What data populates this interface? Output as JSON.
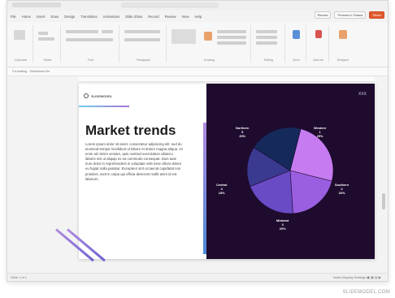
{
  "app": {
    "menu": [
      "File",
      "Home",
      "Insert",
      "Draw",
      "Design",
      "Transitions",
      "Animations",
      "Slide Show",
      "Record",
      "Review",
      "View",
      "Help"
    ],
    "buttons": {
      "record": "Record",
      "present": "Present in Teams",
      "share": "Share"
    }
  },
  "ribbon": {
    "groups": [
      "Clipboard",
      "Slides",
      "Font",
      "Paragraph",
      "Drawing",
      "Editing",
      "Voice",
      "Add-ins",
      "Designer"
    ]
  },
  "formula_bar": {
    "text": "Formatting  ·  SlideModel file"
  },
  "slide": {
    "logo": "SLIDEMODEL",
    "title": "Market trends",
    "body": "Lorem ipsum dolor sit amet, consectetur adipiscing elit, sed do eiusmod tempor incididunt ut labore et dolore magna aliqua. Ut enim ad minim veniam, quis nostrud exercitation ullamco laboris nisi ut aliquip ex ea commodo consequat. Duis aute irure dolor in reprehenderit in voluptate velit esse cillum dolore eu fugiat nulla pariatur. Excepteur sint occaecat cupidatat non proident, sunt in culpa qui officia deserunt mollit anim id est laborum.",
    "page_number": "XXX"
  },
  "chart_data": {
    "type": "pie",
    "title": "",
    "slices": [
      {
        "label": "Western",
        "value": 25,
        "color": "#c67cf0"
      },
      {
        "label": "Southern",
        "value": 20,
        "color": "#9a5fe0"
      },
      {
        "label": "Midwest",
        "value": 20,
        "color": "#6a4bc6"
      },
      {
        "label": "Central",
        "value": 15,
        "color": "#3b3a91"
      },
      {
        "label": "Northern",
        "value": 20,
        "color": "#15295a"
      }
    ],
    "label_text": [
      {
        "name": "Northern",
        "num": "5",
        "pct": "20%"
      },
      {
        "name": "Western",
        "num": "1",
        "pct": "25%"
      },
      {
        "name": "Southern",
        "num": "2",
        "pct": "20%"
      },
      {
        "name": "Midwest",
        "num": "3",
        "pct": "20%"
      },
      {
        "name": "Central",
        "num": "4",
        "pct": "15%"
      }
    ]
  },
  "status": {
    "left": "Slide 1 of 1",
    "right": "Notes   Display Settings   ▣  ▦  ▤  ▶"
  },
  "left_note": "Slide 1 of 1",
  "credit": "SLIDEMODEL.COM"
}
